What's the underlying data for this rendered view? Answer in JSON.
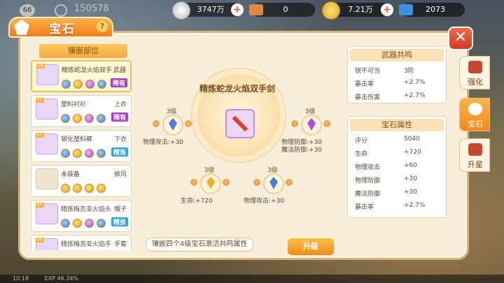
{
  "hud": {
    "player_level": "66",
    "power": "150578",
    "silver": "3747万",
    "star_ticket": "0",
    "gold": "7.21万",
    "diamond": "2073",
    "bottom_time": "10:18",
    "bottom_exp": "EXP 46.34%"
  },
  "panel": {
    "title": "宝石",
    "help": "?",
    "close": "✕"
  },
  "slot_list": {
    "header": "镶嵌部位",
    "items": [
      {
        "level": "56",
        "name": "精炼蛇龙火焰双手",
        "part": "武器",
        "rarity": "稀有"
      },
      {
        "level": "41",
        "name": "塑料衬衫",
        "part": "上衣",
        "rarity": "稀有"
      },
      {
        "level": "53",
        "name": "钢化塑料裤",
        "part": "下衣",
        "rarity": "精良"
      },
      {
        "level": "",
        "name": "未装备",
        "part": "披风",
        "rarity": ""
      },
      {
        "level": "56",
        "name": "精炼梅吉亚火焰头",
        "part": "帽子",
        "rarity": "精良"
      },
      {
        "level": "56",
        "name": "精炼梅吉亚火焰手",
        "part": "手套",
        "rarity": ""
      }
    ]
  },
  "center": {
    "item_name": "精炼蛇龙火焰双手剑",
    "gems": [
      {
        "level": "3级",
        "stat": "物理攻击:+30",
        "stat2": "",
        "color": "#4a7de0"
      },
      {
        "level": "3级",
        "stat": "物理防御:+30",
        "stat2": "魔法防御:+30",
        "color": "#b24ad8"
      },
      {
        "level": "3级",
        "stat": "生命:+720",
        "stat2": "",
        "color": "#f0b020"
      },
      {
        "level": "3级",
        "stat": "物理攻击:+30",
        "stat2": "",
        "color": "#4a7de0"
      }
    ],
    "hint": "镶嵌四个4级宝石激活共鸣属性",
    "upgrade": "升级"
  },
  "resonance": {
    "title": "武器共鸣",
    "rows": [
      {
        "k": "锐不可当",
        "v": "3阶"
      },
      {
        "k": "暴击率",
        "v": "+2.7%"
      },
      {
        "k": "暴击伤害",
        "v": "+2.7%"
      }
    ]
  },
  "gem_attrs": {
    "title": "宝石属性",
    "rows": [
      {
        "k": "评分",
        "v": "5040"
      },
      {
        "k": "生命",
        "v": "+720"
      },
      {
        "k": "物理攻击",
        "v": "+60"
      },
      {
        "k": "物理防御",
        "v": "+30"
      },
      {
        "k": "魔法防御",
        "v": "+30"
      },
      {
        "k": "暴击率",
        "v": "+2.7%"
      }
    ]
  },
  "side_tabs": [
    {
      "label": "强化"
    },
    {
      "label": "宝石"
    },
    {
      "label": "升星"
    }
  ]
}
